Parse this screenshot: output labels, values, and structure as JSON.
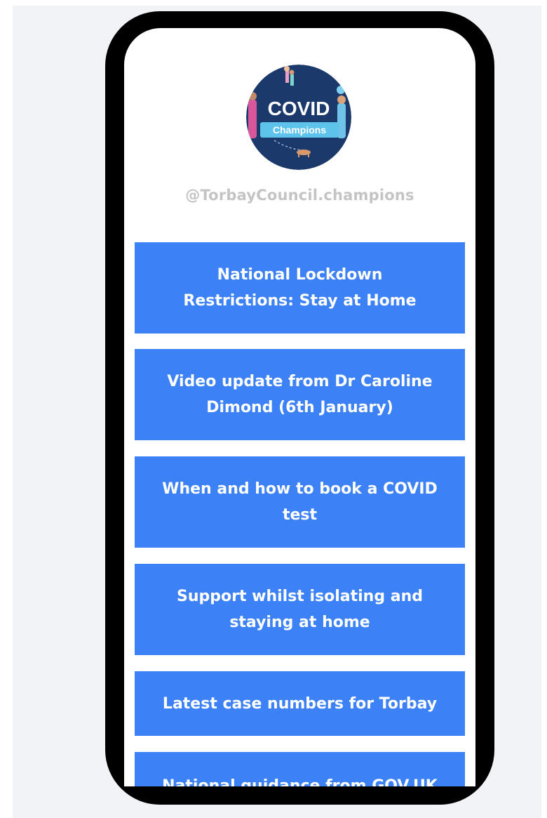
{
  "profile": {
    "handle": "@TorbayCouncil.champions",
    "logo": {
      "line1": "COVID",
      "line2": "Champions"
    }
  },
  "links": [
    {
      "label": "National Lockdown Restrictions: Stay at Home"
    },
    {
      "label": "Video update from Dr Caroline Dimond (6th January)"
    },
    {
      "label": "When and how to book a COVID test"
    },
    {
      "label": "Support whilst isolating and staying at home"
    },
    {
      "label": "Latest case numbers for Torbay"
    },
    {
      "label": "National guidance from GOV.UK"
    }
  ],
  "colors": {
    "button": "#3c82f6",
    "button_text": "#ffffff",
    "handle_text": "#c4c4c4",
    "phone_frame": "#000000",
    "page_background": "#f2f3f6",
    "logo_background": "#1b3a6b"
  }
}
